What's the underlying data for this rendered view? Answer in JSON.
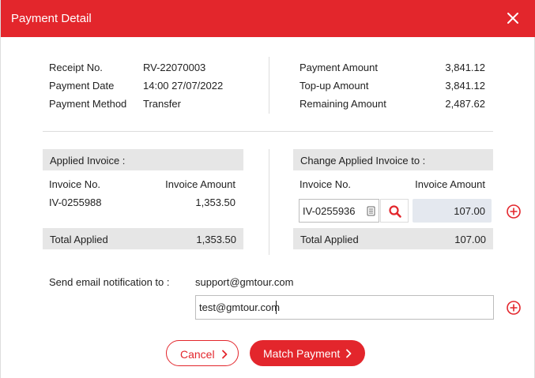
{
  "header": {
    "title": "Payment Detail"
  },
  "receipt": {
    "receipt_no_label": "Receipt No.",
    "receipt_no": "RV-22070003",
    "payment_date_label": "Payment Date",
    "payment_date": "14:00 27/07/2022",
    "payment_method_label": "Payment Method",
    "payment_method": "Transfer"
  },
  "amounts": {
    "payment_amount_label": "Payment Amount",
    "payment_amount": "3,841.12",
    "topup_amount_label": "Top-up Amount",
    "topup_amount": "3,841.12",
    "remaining_amount_label": "Remaining Amount",
    "remaining_amount": "2,487.62"
  },
  "applied": {
    "title": "Applied Invoice :",
    "col_invoice_no": "Invoice No.",
    "col_invoice_amount": "Invoice Amount",
    "rows": [
      {
        "invoice_no": "IV-0255988",
        "amount": "1,353.50"
      }
    ],
    "total_label": "Total Applied",
    "total": "1,353.50"
  },
  "change": {
    "title_prefix": "Change",
    "title_rest": " Applied Invoice to :",
    "col_invoice_no": "Invoice No.",
    "col_invoice_amount": "Invoice Amount",
    "input_value": "IV-0255936",
    "amount": "107.00",
    "total_label": "Total Applied",
    "total": "107.00"
  },
  "email": {
    "label": "Send email notification to :",
    "default_email": "support@gmtour.com",
    "input_value": "test@gmtour.com"
  },
  "buttons": {
    "cancel": "Cancel",
    "match": "Match Payment"
  },
  "colors": {
    "accent": "#e3262c",
    "bar": "#e6e6e6",
    "amount_box": "#e4e8ef"
  }
}
